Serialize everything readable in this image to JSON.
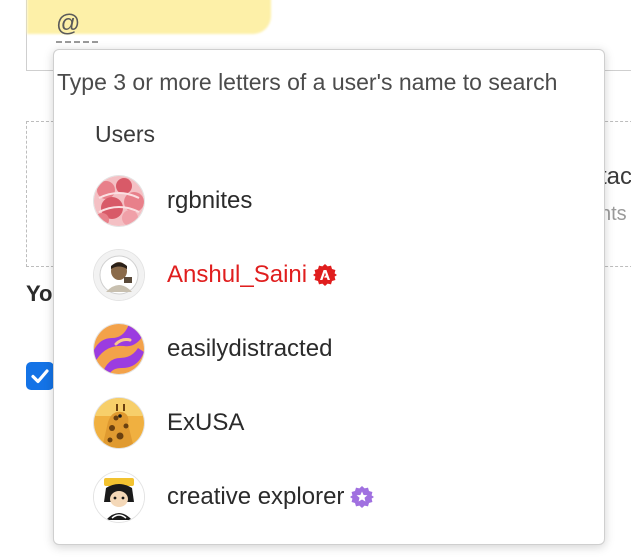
{
  "composer": {
    "mention_token": "@"
  },
  "background": {
    "card_title_fragment": "tac",
    "card_subtitle_fragment": "nts",
    "section_fragment": "You",
    "checkbox_checked": true
  },
  "mention_popover": {
    "hint": "Type 3 or more letters of a user's name to search",
    "section_label": "Users",
    "users": [
      {
        "name": "rgbnites",
        "avatar": "pink-pattern-avatar",
        "badge": null,
        "highlight": false
      },
      {
        "name": "Anshul_Saini",
        "avatar": "photo-avatar",
        "badge": "adobe-staff-badge",
        "highlight": true
      },
      {
        "name": "easilydistracted",
        "avatar": "orange-purple-swirl-avatar",
        "badge": null,
        "highlight": false
      },
      {
        "name": "ExUSA",
        "avatar": "giraffe-avatar",
        "badge": null,
        "highlight": false
      },
      {
        "name": "creative explorer",
        "avatar": "cartoon-character-avatar",
        "badge": "purple-star-badge",
        "highlight": false
      }
    ]
  },
  "colors": {
    "highlight_yellow": "#fdf0a8",
    "staff_name_red": "#e01e1e",
    "checkbox_blue": "#1473e6",
    "star_badge_purple": "#a070e0"
  }
}
